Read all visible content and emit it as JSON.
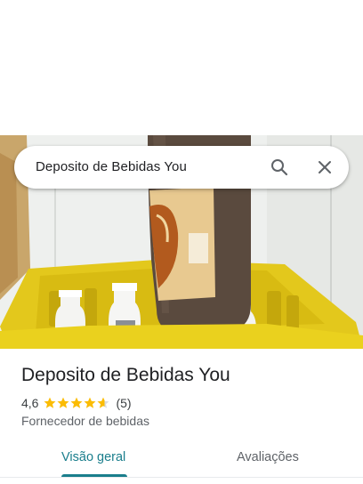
{
  "search": {
    "query": "Deposito de Bebidas You",
    "search_icon": "search-icon",
    "close_icon": "close-icon"
  },
  "photo": {
    "subject": "store-photo"
  },
  "place": {
    "name": "Deposito de Bebidas You",
    "rating": "4,6",
    "rating_stars": 4.6,
    "reviews": "(5)",
    "category": "Fornecedor de bebidas"
  },
  "tabs": [
    {
      "label": "Visão geral",
      "selected": true
    },
    {
      "label": "Avaliações",
      "selected": false
    }
  ],
  "colors": {
    "accent": "#1a7e8c",
    "star": "#fbbc04",
    "star_empty": "#dadce0"
  }
}
